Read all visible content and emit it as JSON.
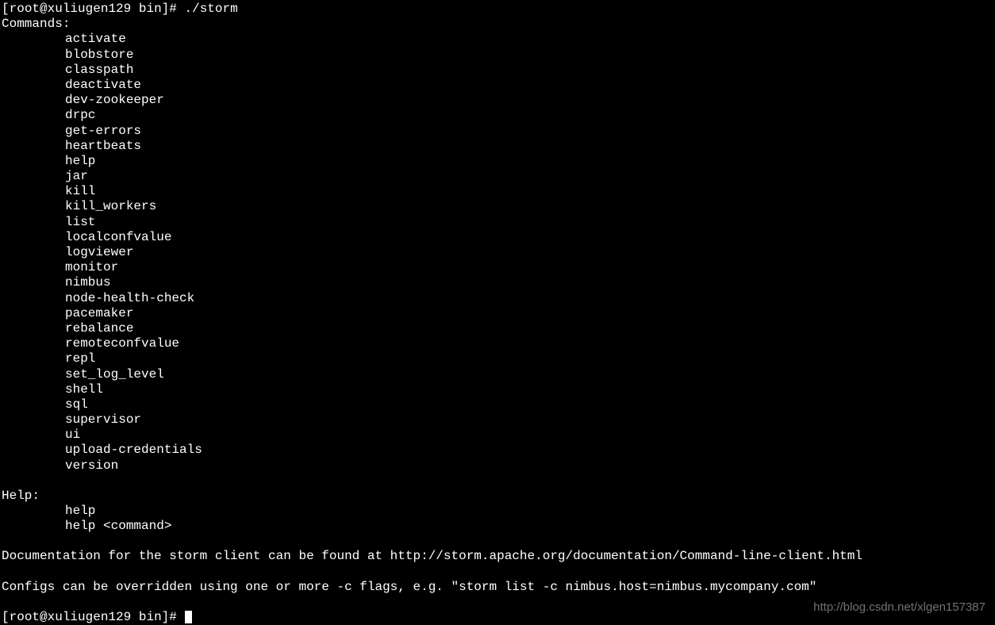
{
  "prompt1": {
    "user": "root",
    "host": "xuliugen129",
    "dir": "bin",
    "symbol": "#",
    "command": "./storm"
  },
  "commands_header": "Commands:",
  "commands": [
    "activate",
    "blobstore",
    "classpath",
    "deactivate",
    "dev-zookeeper",
    "drpc",
    "get-errors",
    "heartbeats",
    "help",
    "jar",
    "kill",
    "kill_workers",
    "list",
    "localconfvalue",
    "logviewer",
    "monitor",
    "nimbus",
    "node-health-check",
    "pacemaker",
    "rebalance",
    "remoteconfvalue",
    "repl",
    "set_log_level",
    "shell",
    "sql",
    "supervisor",
    "ui",
    "upload-credentials",
    "version"
  ],
  "help_header": "Help:",
  "help_lines": [
    "help",
    "help <command>"
  ],
  "doc_line": "Documentation for the storm client can be found at http://storm.apache.org/documentation/Command-line-client.html",
  "config_line": "Configs can be overridden using one or more -c flags, e.g. \"storm list -c nimbus.host=nimbus.mycompany.com\"",
  "prompt2": {
    "user": "root",
    "host": "xuliugen129",
    "dir": "bin",
    "symbol": "#"
  },
  "watermark": "http://blog.csdn.net/xlgen157387"
}
